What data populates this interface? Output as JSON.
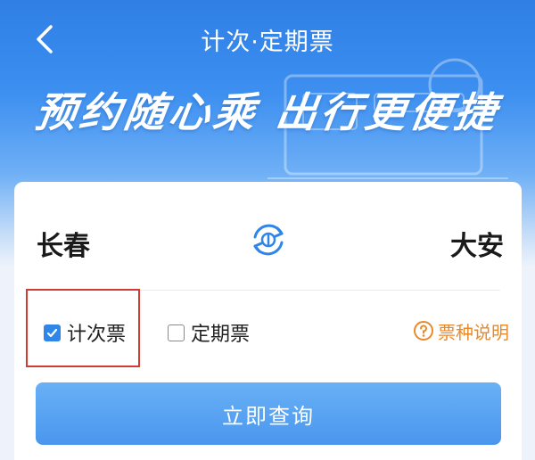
{
  "header": {
    "title": "计次·定期票",
    "back_icon": "chevron-left-icon"
  },
  "banner": {
    "slogan": "预约随心乘 出行更便捷"
  },
  "route": {
    "from": "长春",
    "to": "大安",
    "swap_icon": "swap-stations-icon"
  },
  "ticket_types": {
    "options": [
      {
        "label": "计次票",
        "checked": true
      },
      {
        "label": "定期票",
        "checked": false
      }
    ],
    "help_label": "票种说明",
    "help_icon": "question-circle-icon"
  },
  "actions": {
    "query_label": "立即查询"
  },
  "colors": {
    "primary": "#2f86e8",
    "help_text": "#e88a2c",
    "highlight": "#d23b34",
    "button": "#4a96ee"
  }
}
